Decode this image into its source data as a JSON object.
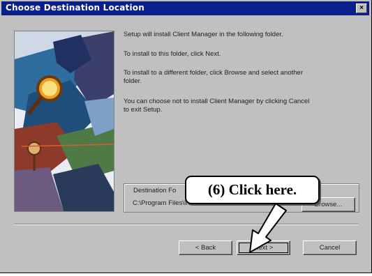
{
  "window": {
    "title": "Choose Destination Location",
    "close_glyph": "×"
  },
  "body": {
    "line1": "Setup will install Client Manager in the following folder.",
    "line2": "To install to this folder, click Next.",
    "line3a": "To install to a different folder, click Browse and select another",
    "line3b": "folder.",
    "line4a": "You can choose not to install Client Manager by clicking Cancel",
    "line4b": "to exit Setup."
  },
  "destination": {
    "label": "Destination Fo",
    "path": "C:\\Program Files\\Intel\\LDCM",
    "browse_label": "Browse..."
  },
  "buttons": {
    "back_label": "< Back",
    "next_label": "Next >",
    "cancel_label": "Cancel"
  },
  "callout": {
    "text": "(6)  Click here."
  }
}
